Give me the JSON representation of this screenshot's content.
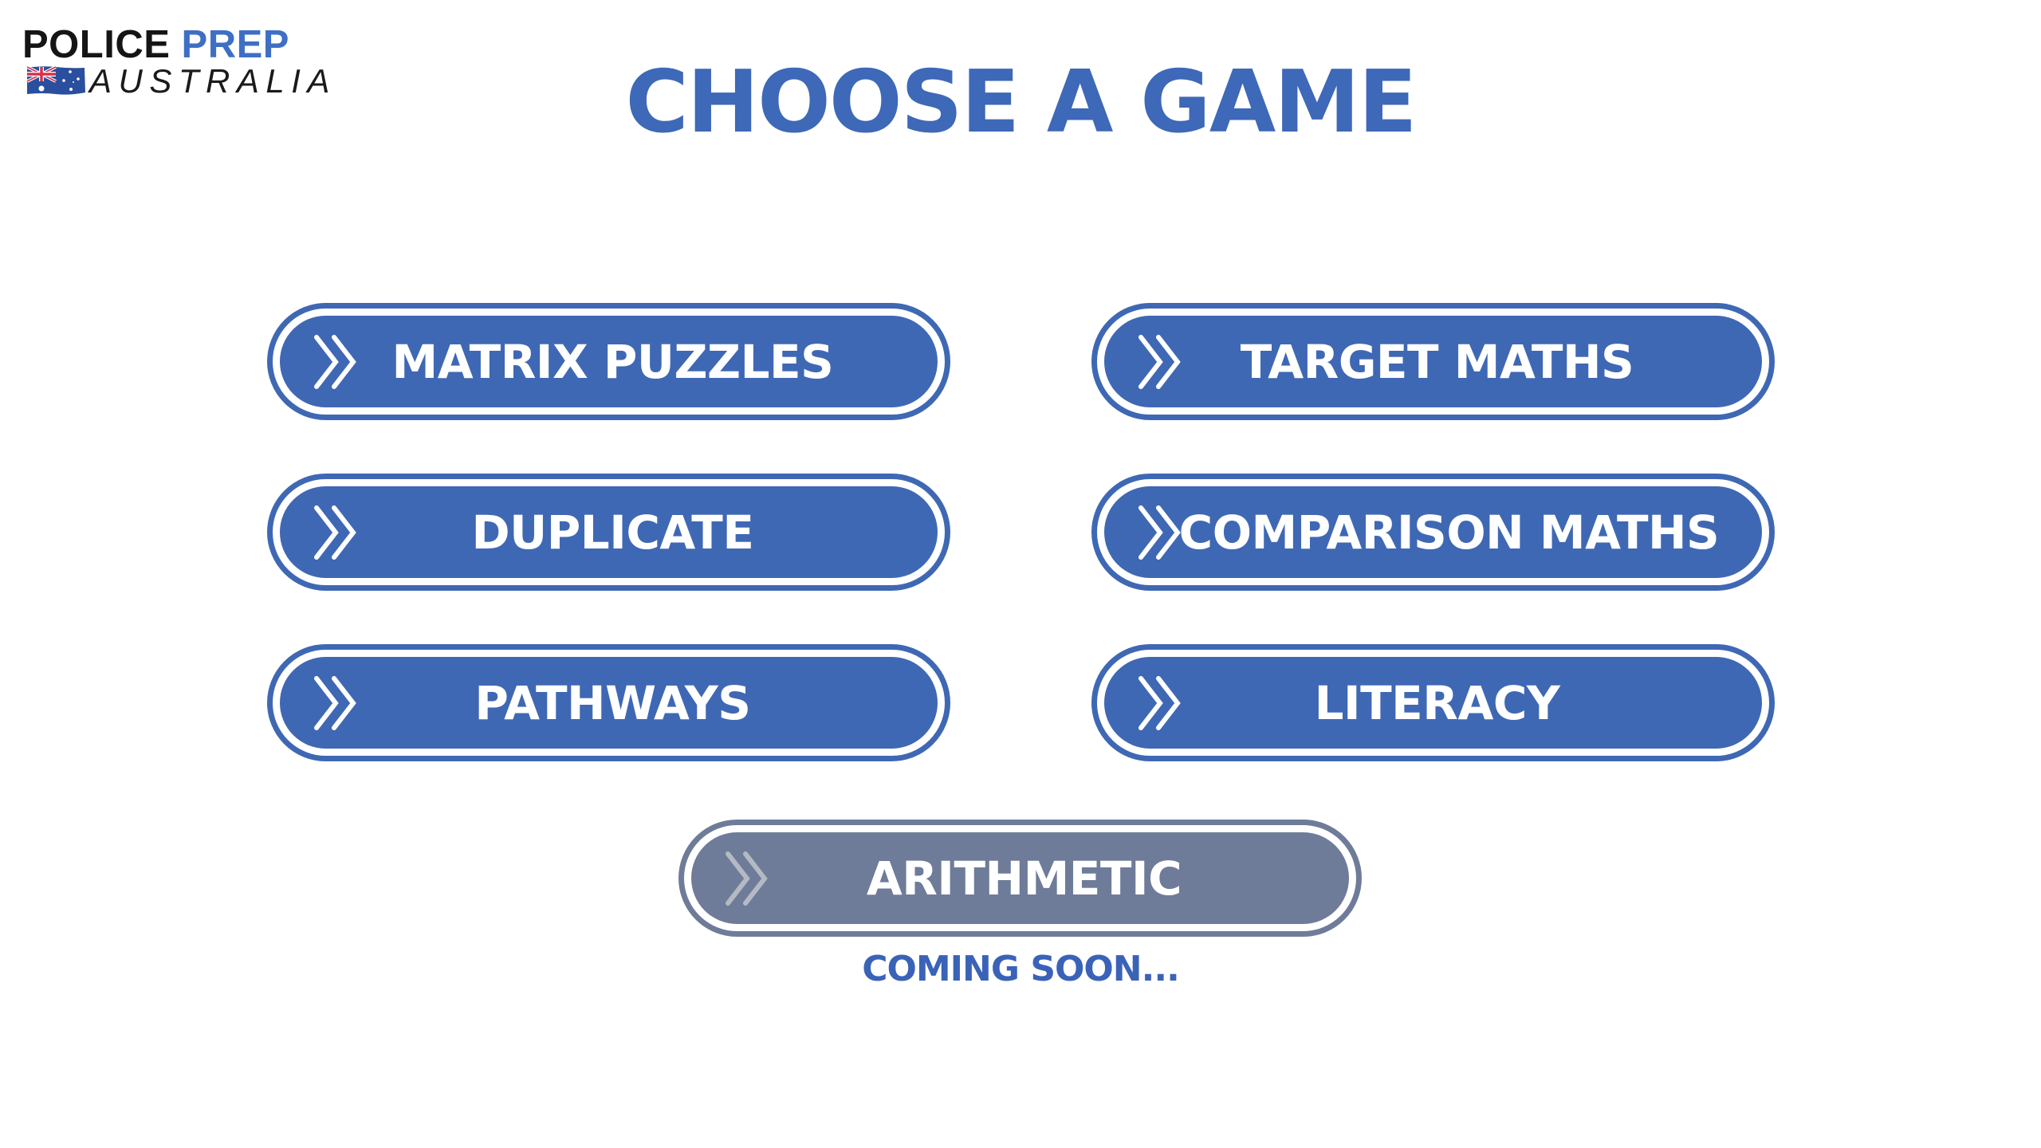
{
  "logo": {
    "line1_part1": "POLICE",
    "line1_part2": "PREP",
    "line2": "AUSTRALIA",
    "flag_icon": "australian-flag-icon",
    "colors": {
      "police": "#151515",
      "prep": "#3e6fc4"
    }
  },
  "header": {
    "title": "CHOOSE A GAME"
  },
  "games": [
    {
      "label": "MATRIX PUZZLES",
      "icon": "double-chevron-right-icon",
      "enabled": true
    },
    {
      "label": "TARGET MATHS",
      "icon": "double-chevron-right-icon",
      "enabled": true
    },
    {
      "label": "DUPLICATE",
      "icon": "double-chevron-right-icon",
      "enabled": true
    },
    {
      "label": "COMPARISON MATHS",
      "icon": "double-chevron-right-icon",
      "enabled": true
    },
    {
      "label": "PATHWAYS",
      "icon": "double-chevron-right-icon",
      "enabled": true
    },
    {
      "label": "LITERACY",
      "icon": "double-chevron-right-icon",
      "enabled": true
    },
    {
      "label": "ARITHMETIC",
      "icon": "double-chevron-right-icon",
      "enabled": false
    }
  ],
  "coming_soon": "COMING SOON...",
  "colors": {
    "accent": "#3f68b4",
    "title": "#3e68b8",
    "disabled": "#6e7c99",
    "disabled_icon": "#b5b9c2",
    "button_text": "#ffffff",
    "background": "#ffffff"
  }
}
